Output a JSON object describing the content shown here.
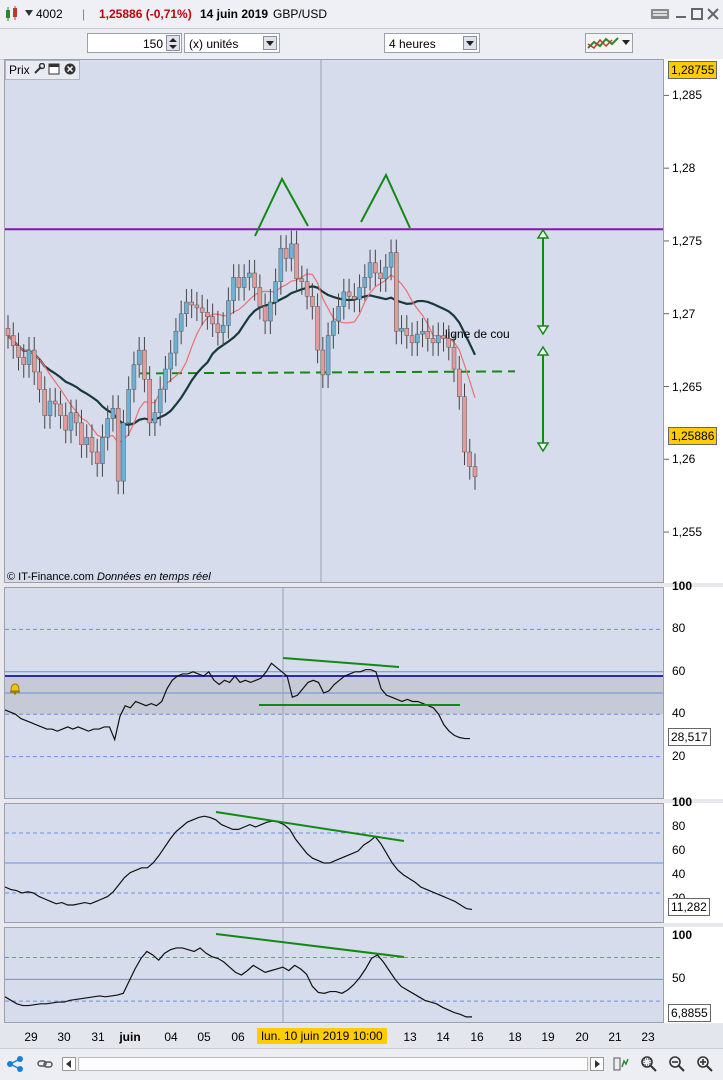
{
  "header": {
    "id": "4002",
    "change": "1,25886 (-0,71%)",
    "date": "14 juin 2019",
    "instrument": "GBP/USD",
    "separator": "|"
  },
  "toolbar": {
    "quantity": "150",
    "units": "(x) unités",
    "timeframe": "4 heures"
  },
  "price_panel": {
    "title": "Prix",
    "copyright": "© IT-Finance.com",
    "realtime": "Données en temps réel",
    "annotation": "ligne de cou",
    "top_value": "1,28755",
    "last_value": "1,25886"
  },
  "rsi_panel": {
    "value": "28,517"
  },
  "panel3": {
    "value": "11,282"
  },
  "panel4": {
    "value": "6,8855"
  },
  "x_axis": {
    "labels": [
      "29",
      "30",
      "31",
      "juin",
      "04",
      "05",
      "06",
      "lun. 10 juin 2019 10:00",
      "13",
      "14",
      "16",
      "18",
      "19",
      "20",
      "21",
      "23"
    ]
  },
  "colors": {
    "background": "#d6dcec",
    "bull": "#6fb1d6",
    "bear": "#e39a9a",
    "resistance": "#8a10b8",
    "trend": "#118a11",
    "ma_long": "#173a3a",
    "ma_short": "#ee6f6f",
    "highlight": "#ffcc00"
  },
  "chart_data": [
    {
      "type": "candlestick",
      "title": "Prix",
      "yticks": [
        "1,285",
        "1,28",
        "1,275",
        "1,27",
        "1,265",
        "1,26",
        "1,255"
      ],
      "ylim": [
        1.2515,
        1.2875
      ],
      "resistance_level": 1.2758,
      "neckline_level": 1.2659,
      "last": 1.25886,
      "close": [
        1.2685,
        1.2678,
        1.267,
        1.2665,
        1.2675,
        1.266,
        1.2648,
        1.263,
        1.264,
        1.2638,
        1.263,
        1.262,
        1.2632,
        1.2625,
        1.261,
        1.2615,
        1.2605,
        1.2597,
        1.2615,
        1.2628,
        1.2635,
        1.2585,
        1.2625,
        1.2648,
        1.2665,
        1.2675,
        1.2655,
        1.2625,
        1.2632,
        1.2648,
        1.2662,
        1.2673,
        1.2688,
        1.27,
        1.2708,
        1.2706,
        1.2704,
        1.2701,
        1.2698,
        1.2693,
        1.2687,
        1.2692,
        1.2709,
        1.2725,
        1.2718,
        1.2725,
        1.2728,
        1.2718,
        1.2705,
        1.2695,
        1.2708,
        1.2722,
        1.2745,
        1.2738,
        1.2748,
        1.2724,
        1.2722,
        1.2712,
        1.2705,
        1.2675,
        1.2658,
        1.2685,
        1.2695,
        1.2705,
        1.2715,
        1.2712,
        1.271,
        1.2718,
        1.2725,
        1.2735,
        1.2728,
        1.2724,
        1.2732,
        1.2742,
        1.2688,
        1.269,
        1.2685,
        1.268,
        1.2686,
        1.2688,
        1.2683,
        1.268,
        1.2685,
        1.2683,
        1.2677,
        1.2662,
        1.2643,
        1.2605,
        1.2595,
        1.2588
      ],
      "moving_averages": [
        "long",
        "short"
      ]
    },
    {
      "type": "line",
      "yticks": [
        "100",
        "80",
        "60",
        "40",
        "20"
      ],
      "ylim": [
        0,
        100
      ],
      "levels": [
        80,
        60,
        50,
        40,
        20
      ],
      "last": 28.517,
      "values": [
        42,
        41,
        40,
        38,
        37,
        36,
        35,
        34,
        33,
        33,
        32,
        33,
        34,
        33,
        34,
        33,
        32,
        33,
        33,
        34,
        34,
        28,
        39,
        44,
        43,
        46,
        45,
        44,
        45,
        44,
        46,
        52,
        56,
        58,
        59,
        59,
        60,
        59,
        58,
        60,
        56,
        54,
        56,
        55,
        58,
        55,
        56,
        55,
        56,
        57,
        60,
        64,
        62,
        60,
        58,
        48,
        49,
        52,
        55,
        56,
        55,
        50,
        51,
        54,
        56,
        58,
        59,
        60,
        60,
        61,
        61,
        60,
        52,
        49,
        48,
        47,
        46,
        47,
        46,
        46,
        45,
        44,
        43,
        40,
        35,
        32,
        30,
        29,
        28.5,
        28.5
      ],
      "overlap_extra": null
    },
    {
      "type": "line",
      "yticks": [
        "100",
        "80",
        "60",
        "40",
        "20"
      ],
      "ylim": [
        0,
        100
      ],
      "levels": [
        75,
        50,
        25
      ],
      "last": 11.282,
      "values": [
        30,
        28,
        27,
        25,
        26,
        25,
        22,
        20,
        18,
        16,
        17,
        15,
        15,
        16,
        17,
        16,
        18,
        20,
        22,
        26,
        32,
        38,
        42,
        44,
        46,
        46,
        50,
        56,
        63,
        70,
        76,
        80,
        84,
        86,
        88,
        89,
        88,
        86,
        82,
        80,
        78,
        78,
        80,
        82,
        80,
        82,
        84,
        85,
        84,
        82,
        78,
        70,
        64,
        58,
        54,
        52,
        50,
        50,
        52,
        54,
        56,
        58,
        60,
        65,
        68,
        72,
        66,
        58,
        50,
        44,
        40,
        37,
        34,
        30,
        28,
        26,
        24,
        22,
        20,
        18,
        15,
        12,
        11.3
      ]
    },
    {
      "type": "line",
      "yticks": [
        "100",
        "50"
      ],
      "ylim": [
        0,
        110
      ],
      "levels": [
        75,
        50,
        25
      ],
      "last": 6.8855,
      "values": [
        30,
        26,
        22,
        20,
        20,
        21,
        22,
        22,
        23,
        24,
        24,
        26,
        27,
        28,
        29,
        30,
        31,
        30,
        31,
        32,
        34,
        48,
        62,
        74,
        82,
        78,
        72,
        80,
        84,
        86,
        86,
        84,
        82,
        86,
        80,
        76,
        74,
        70,
        64,
        58,
        55,
        60,
        66,
        62,
        58,
        60,
        62,
        64,
        60,
        66,
        62,
        56,
        42,
        35,
        34,
        36,
        36,
        34,
        38,
        44,
        52,
        62,
        74,
        78,
        70,
        60,
        50,
        42,
        38,
        34,
        30,
        26,
        24,
        22,
        18,
        15,
        12,
        10,
        7,
        7
      ]
    }
  ]
}
